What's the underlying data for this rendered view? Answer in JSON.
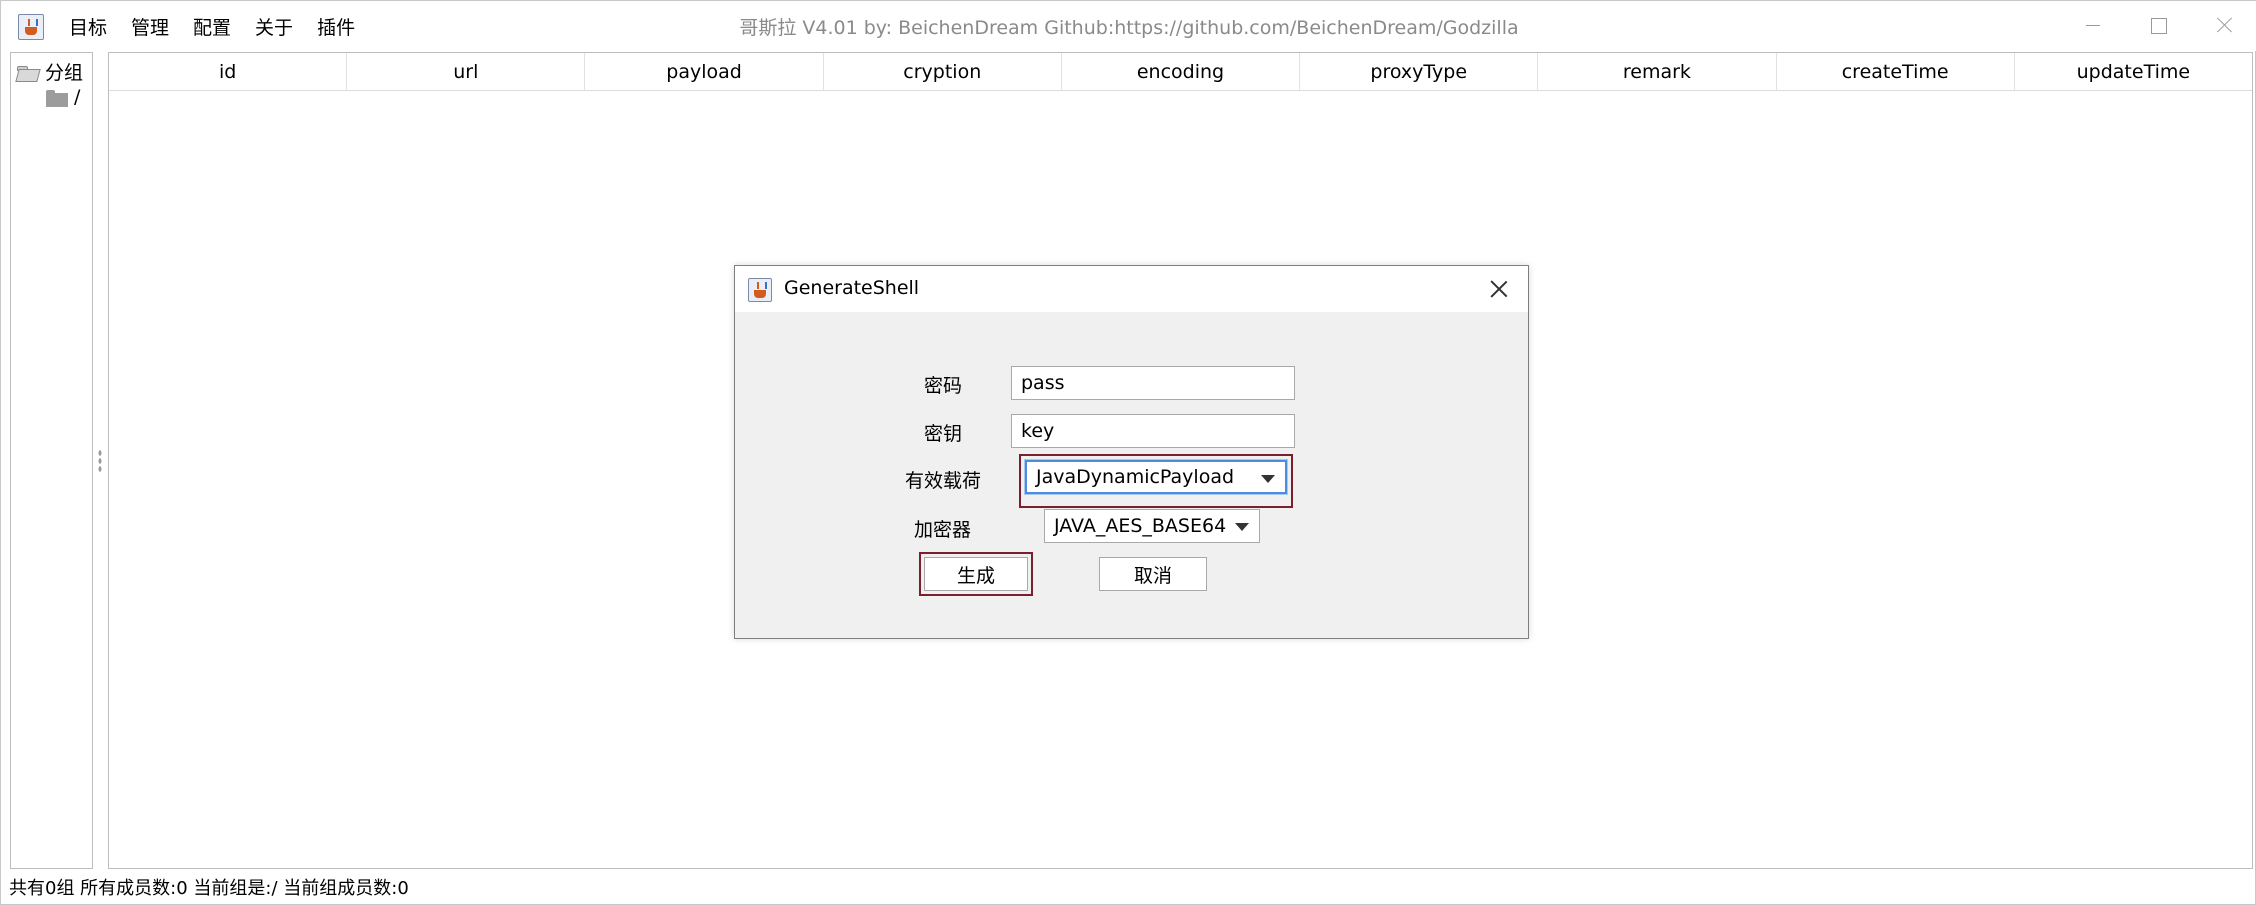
{
  "menu": {
    "items": [
      "目标",
      "管理",
      "配置",
      "关于",
      "插件"
    ]
  },
  "window": {
    "title": "哥斯拉   V4.01 by: BeichenDream Github:https://github.com/BeichenDream/Godzilla"
  },
  "tree": {
    "root_label": "分组",
    "child_label": "/"
  },
  "table": {
    "columns": [
      "id",
      "url",
      "payload",
      "cryption",
      "encoding",
      "proxyType",
      "remark",
      "createTime",
      "updateTime"
    ]
  },
  "status": {
    "text": "共有0组 所有成员数:0 当前组是:/ 当前组成员数:0"
  },
  "dialog": {
    "title": "GenerateShell",
    "password_label": "密码",
    "password_value": "pass",
    "key_label": "密钥",
    "key_value": "key",
    "payload_label": "有效载荷",
    "payload_selected": "JavaDynamicPayload",
    "cryption_label": "加密器",
    "cryption_selected": "JAVA_AES_BASE64",
    "generate_label": "生成",
    "cancel_label": "取消"
  },
  "colors": {
    "highlight": "#7b1f2e",
    "focus": "#4a8de0",
    "title_text": "#8a8a8a"
  }
}
